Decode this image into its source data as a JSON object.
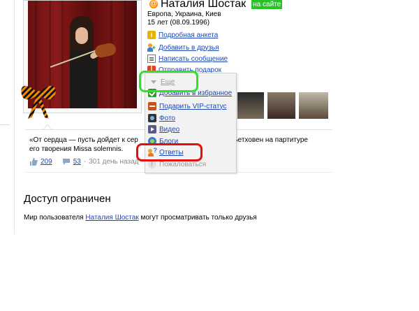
{
  "profile": {
    "name": "Наталия Шостак",
    "online_badge": "на сайте",
    "location": "Европа, Украина, Киев",
    "age": "15 лет (08.09.1996)"
  },
  "actions": [
    {
      "label": "Подробная анкета",
      "icon": "info-icon"
    },
    {
      "label": "Добавить в друзья",
      "icon": "add-friend-icon"
    },
    {
      "label": "Написать сообщение",
      "icon": "message-icon"
    },
    {
      "label": "Отправить подарок",
      "icon": "gift-icon"
    }
  ],
  "more_menu": {
    "toggle_label": "Еще",
    "items": [
      {
        "label": "Добавить в избранное",
        "icon": "check-icon"
      },
      {
        "label": "Подарить VIP-статус",
        "icon": "vip-icon"
      },
      {
        "label": "Фото",
        "icon": "camera-icon"
      },
      {
        "label": "Видео",
        "icon": "video-icon"
      },
      {
        "label": "Блоги",
        "icon": "blog-icon"
      },
      {
        "label": "Ответы",
        "icon": "answers-icon"
      },
      {
        "label": "Пожаловаться",
        "icon": "complain-icon"
      }
    ]
  },
  "status": {
    "line1_left": "«От сердца — пусть дойдет к сер",
    "line1_right": "ан Бетховен на партитуре",
    "line2": "его творения Missa solemnis.",
    "likes": "209",
    "comments": "53",
    "ago": "301 день назад"
  },
  "restricted": {
    "title": "Доступ ограничен",
    "note_prefix": "Мир пользователя",
    "note_user": "Наталия Шостак",
    "note_suffix": "могут просматривать только друзья"
  },
  "colors": {
    "link": "#1c47b6",
    "online": "#29c329",
    "highlight_green": "#2ee32e",
    "highlight_red": "#e01010"
  }
}
